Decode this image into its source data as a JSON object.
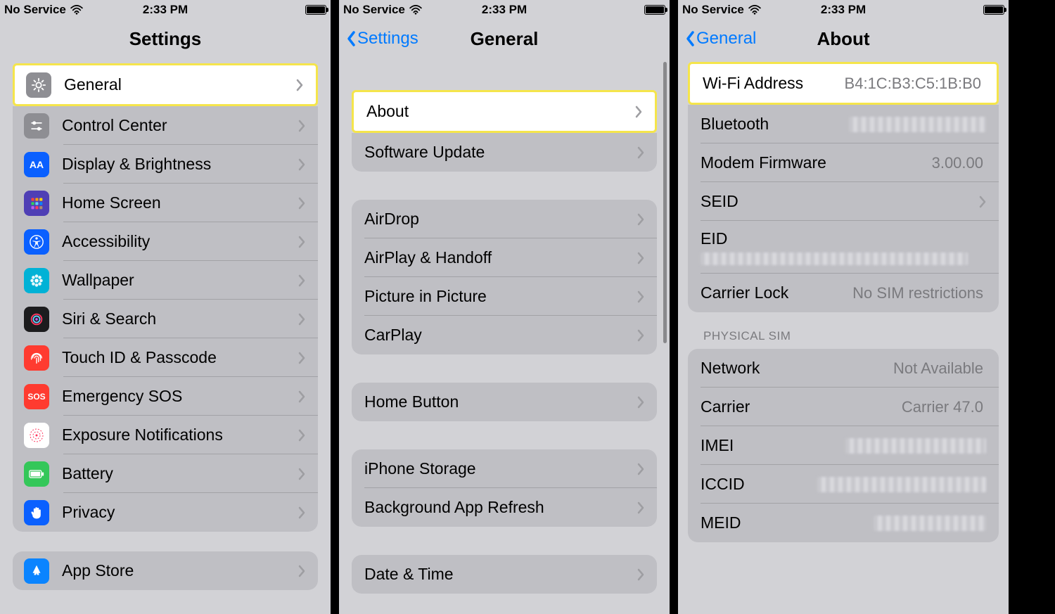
{
  "status": {
    "left": "No Service",
    "time": "2:33 PM"
  },
  "screen1": {
    "title": "Settings",
    "items": [
      {
        "label": "General"
      },
      {
        "label": "Control Center"
      },
      {
        "label": "Display & Brightness"
      },
      {
        "label": "Home Screen"
      },
      {
        "label": "Accessibility"
      },
      {
        "label": "Wallpaper"
      },
      {
        "label": "Siri & Search"
      },
      {
        "label": "Touch ID & Passcode"
      },
      {
        "label": "Emergency SOS"
      },
      {
        "label": "Exposure Notifications"
      },
      {
        "label": "Battery"
      },
      {
        "label": "Privacy"
      }
    ],
    "footer_item": "App Store"
  },
  "screen2": {
    "back": "Settings",
    "title": "General",
    "groups": [
      [
        {
          "label": "About"
        },
        {
          "label": "Software Update"
        }
      ],
      [
        {
          "label": "AirDrop"
        },
        {
          "label": "AirPlay & Handoff"
        },
        {
          "label": "Picture in Picture"
        },
        {
          "label": "CarPlay"
        }
      ],
      [
        {
          "label": "Home Button"
        }
      ],
      [
        {
          "label": "iPhone Storage"
        },
        {
          "label": "Background App Refresh"
        }
      ],
      [
        {
          "label": "Date & Time"
        }
      ]
    ]
  },
  "screen3": {
    "back": "General",
    "title": "About",
    "rows1": [
      {
        "label": "Wi-Fi Address",
        "value": "B4:1C:B3:C5:1B:B0"
      },
      {
        "label": "Bluetooth",
        "blur": true
      },
      {
        "label": "Modem Firmware",
        "value": "3.00.00"
      },
      {
        "label": "SEID",
        "chevron": true
      },
      {
        "label": "EID"
      },
      {
        "label": "Carrier Lock",
        "value": "No SIM restrictions"
      }
    ],
    "section_header": "PHYSICAL SIM",
    "rows2": [
      {
        "label": "Network",
        "value": "Not Available"
      },
      {
        "label": "Carrier",
        "value": "Carrier 47.0"
      },
      {
        "label": "IMEI",
        "blur": true
      },
      {
        "label": "ICCID",
        "blur": true
      },
      {
        "label": "MEID",
        "blur": true
      }
    ]
  },
  "iconcolors": {
    "General": "#8e8e93",
    "Control Center": "#8e8e93",
    "Display & Brightness": "#0a60ff",
    "Home Screen": "#4f3fb5",
    "Accessibility": "#0a60ff",
    "Wallpaper": "#00b2d6",
    "Siri & Search": "#1c1c1e",
    "Touch ID & Passcode": "#ff3b30",
    "Emergency SOS": "#ff3b30",
    "Exposure Notifications": "#ffffff",
    "Battery": "#34c759",
    "Privacy": "#0a60ff",
    "App Store": "#0a84ff"
  }
}
